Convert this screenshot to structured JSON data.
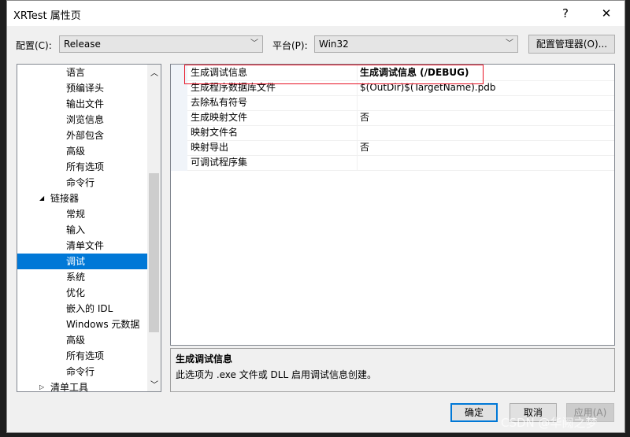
{
  "window": {
    "title": "XRTest 属性页",
    "help": "?",
    "close": "✕"
  },
  "config": {
    "label": "配置(C):",
    "value": "Release",
    "platform_label": "平台(P):",
    "platform_value": "Win32",
    "manager_button": "配置管理器(O)..."
  },
  "tree": {
    "items": [
      {
        "label": "语言",
        "indent": 2
      },
      {
        "label": "预编译头",
        "indent": 2
      },
      {
        "label": "输出文件",
        "indent": 2
      },
      {
        "label": "浏览信息",
        "indent": 2
      },
      {
        "label": "外部包含",
        "indent": 2
      },
      {
        "label": "高级",
        "indent": 2
      },
      {
        "label": "所有选项",
        "indent": 2
      },
      {
        "label": "命令行",
        "indent": 2
      },
      {
        "label": "链接器",
        "indent": 1,
        "expander": "◢"
      },
      {
        "label": "常规",
        "indent": 2
      },
      {
        "label": "输入",
        "indent": 2
      },
      {
        "label": "清单文件",
        "indent": 2
      },
      {
        "label": "调试",
        "indent": 2,
        "selected": true
      },
      {
        "label": "系统",
        "indent": 2
      },
      {
        "label": "优化",
        "indent": 2
      },
      {
        "label": "嵌入的 IDL",
        "indent": 2
      },
      {
        "label": "Windows 元数据",
        "indent": 2
      },
      {
        "label": "高级",
        "indent": 2
      },
      {
        "label": "所有选项",
        "indent": 2
      },
      {
        "label": "命令行",
        "indent": 2
      },
      {
        "label": "清单工具",
        "indent": 1,
        "expander": "▷"
      }
    ]
  },
  "properties": [
    {
      "name": "生成调试信息",
      "value": "生成调试信息 (/DEBUG)",
      "highlighted": true
    },
    {
      "name": "生成程序数据库文件",
      "value": "$(OutDir)$(TargetName).pdb"
    },
    {
      "name": "去除私有符号",
      "value": ""
    },
    {
      "name": "生成映射文件",
      "value": "否"
    },
    {
      "name": "映射文件名",
      "value": ""
    },
    {
      "name": "映射导出",
      "value": "否"
    },
    {
      "name": "可调试程序集",
      "value": ""
    }
  ],
  "description": {
    "title": "生成调试信息",
    "text": "此选项为 .exe 文件或 DLL 启用调试信息创建。"
  },
  "buttons": {
    "ok": "确定",
    "cancel": "取消",
    "apply": "应用(A)"
  },
  "watermark": "CSDN @华阙之梦",
  "colors": {
    "selection": "#0078d7",
    "highlight_border": "#e81123"
  }
}
